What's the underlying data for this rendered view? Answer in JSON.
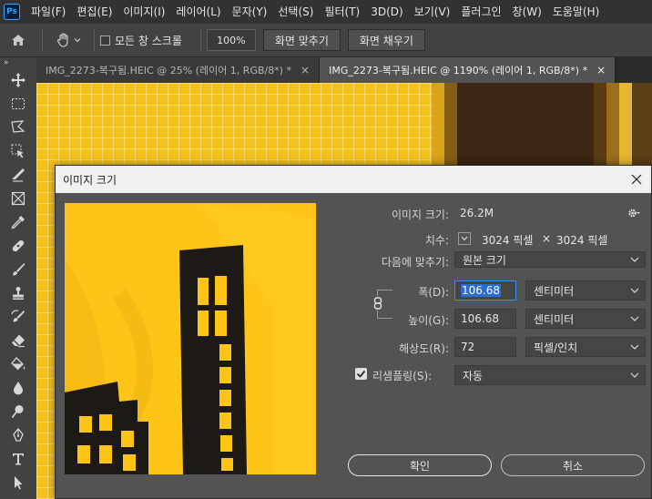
{
  "app": {
    "logo": "Ps"
  },
  "menu": [
    "파일(F)",
    "편집(E)",
    "이미지(I)",
    "레이어(L)",
    "문자(Y)",
    "선택(S)",
    "필터(T)",
    "3D(D)",
    "보기(V)",
    "플러그인",
    "창(W)",
    "도움말(H)"
  ],
  "options": {
    "scroll_all_label": "모든 창 스크롤",
    "zoom_value": "100%",
    "fit_screen_label": "화면 맞추기",
    "fill_screen_label": "화면 채우기"
  },
  "tabs": [
    {
      "label": "IMG_2273-복구됨.HEIC @ 25% (레이어 1, RGB/8*) *",
      "close": "×"
    },
    {
      "label": "IMG_2273-복구됨.HEIC @ 1190% (레이어 1, RGB/8*) *",
      "close": "×"
    }
  ],
  "toolbar": {
    "collapse": "»"
  },
  "dialog": {
    "title": "이미지 크기",
    "image_size_label": "이미지 크기:",
    "image_size_value": "26.2M",
    "dimensions_label": "치수:",
    "dimensions_width": "3024 픽셀",
    "dimensions_x": "×",
    "dimensions_height": "3024 픽셀",
    "fit_to_label": "다음에 맞추기:",
    "fit_to_value": "원본 크기",
    "width_label": "폭(D):",
    "width_value": "106.68",
    "width_unit": "센티미터",
    "height_label": "높이(G):",
    "height_value": "106.68",
    "height_unit": "센티미터",
    "resolution_label": "해상도(R):",
    "resolution_value": "72",
    "resolution_unit": "픽셀/인치",
    "resample_label": "리샘플링(S):",
    "resample_value": "자동",
    "resample_checked": true,
    "ok_label": "확인",
    "cancel_label": "취소"
  },
  "colors": {
    "accent": "#2d6bd4",
    "canvas_yellow": "#f5c21b",
    "building": "#1d1a15"
  }
}
